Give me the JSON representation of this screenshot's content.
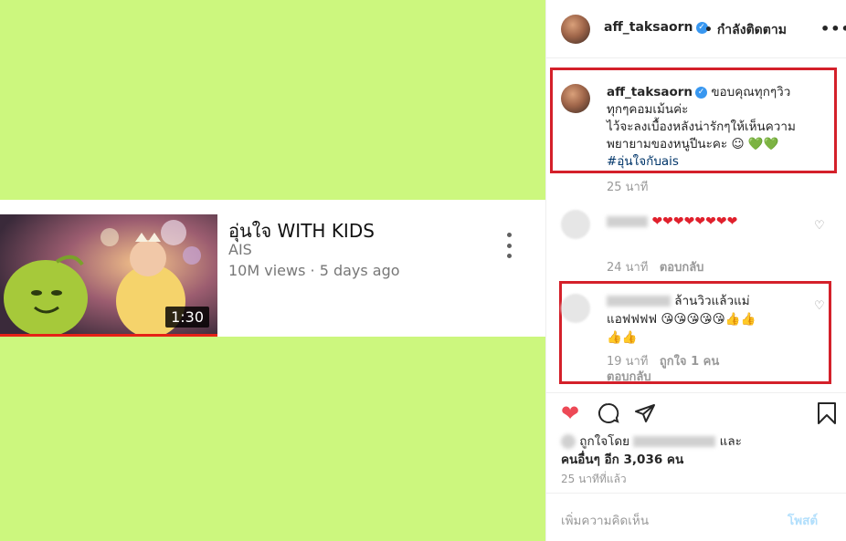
{
  "video": {
    "title": "อุ่นใจ WITH KIDS",
    "channel": "AIS",
    "meta": "10M views · 5 days ago",
    "duration": "1:30"
  },
  "header": {
    "username": "aff_taksaorn",
    "follow_status": "• กำลังติดตาม",
    "more": "•••"
  },
  "caption": {
    "username": "aff_taksaorn",
    "line1": "ขอบคุณทุกๆวิว",
    "line2": "ทุกๆคอมเม้นค่ะ",
    "line3": "ไว้จะลงเบื้องหลังน่ารักๆให้เห็นความ",
    "line4": "พยายามของหนูปีนะคะ ☺",
    "hearts": "💚💚",
    "hashtag": "#อุ่นใจกับais",
    "time": "25 นาที"
  },
  "comments": [
    {
      "text": "❤❤❤❤❤❤❤❤",
      "time": "24 นาที",
      "reply": "ตอบกลับ"
    },
    {
      "text_line1": "ล้านวิวแล้วแม่",
      "text_line2": "แอฟฟฟฟ 😘😘😘😘😘👍👍",
      "text_line3": "👍👍",
      "time": "19 นาที",
      "likes": "ถูกใจ 1 คน",
      "reply": "ตอบกลับ"
    }
  ],
  "likes": {
    "prefix": "ถูกใจโดย",
    "suffix": "และ",
    "others": "คนอื่นๆ อีก 3,036 คน"
  },
  "post_age": "25 นาทีที่แล้ว",
  "comment_box": {
    "placeholder": "เพิ่มความคิดเห็น",
    "post_label": "โพสต์"
  }
}
